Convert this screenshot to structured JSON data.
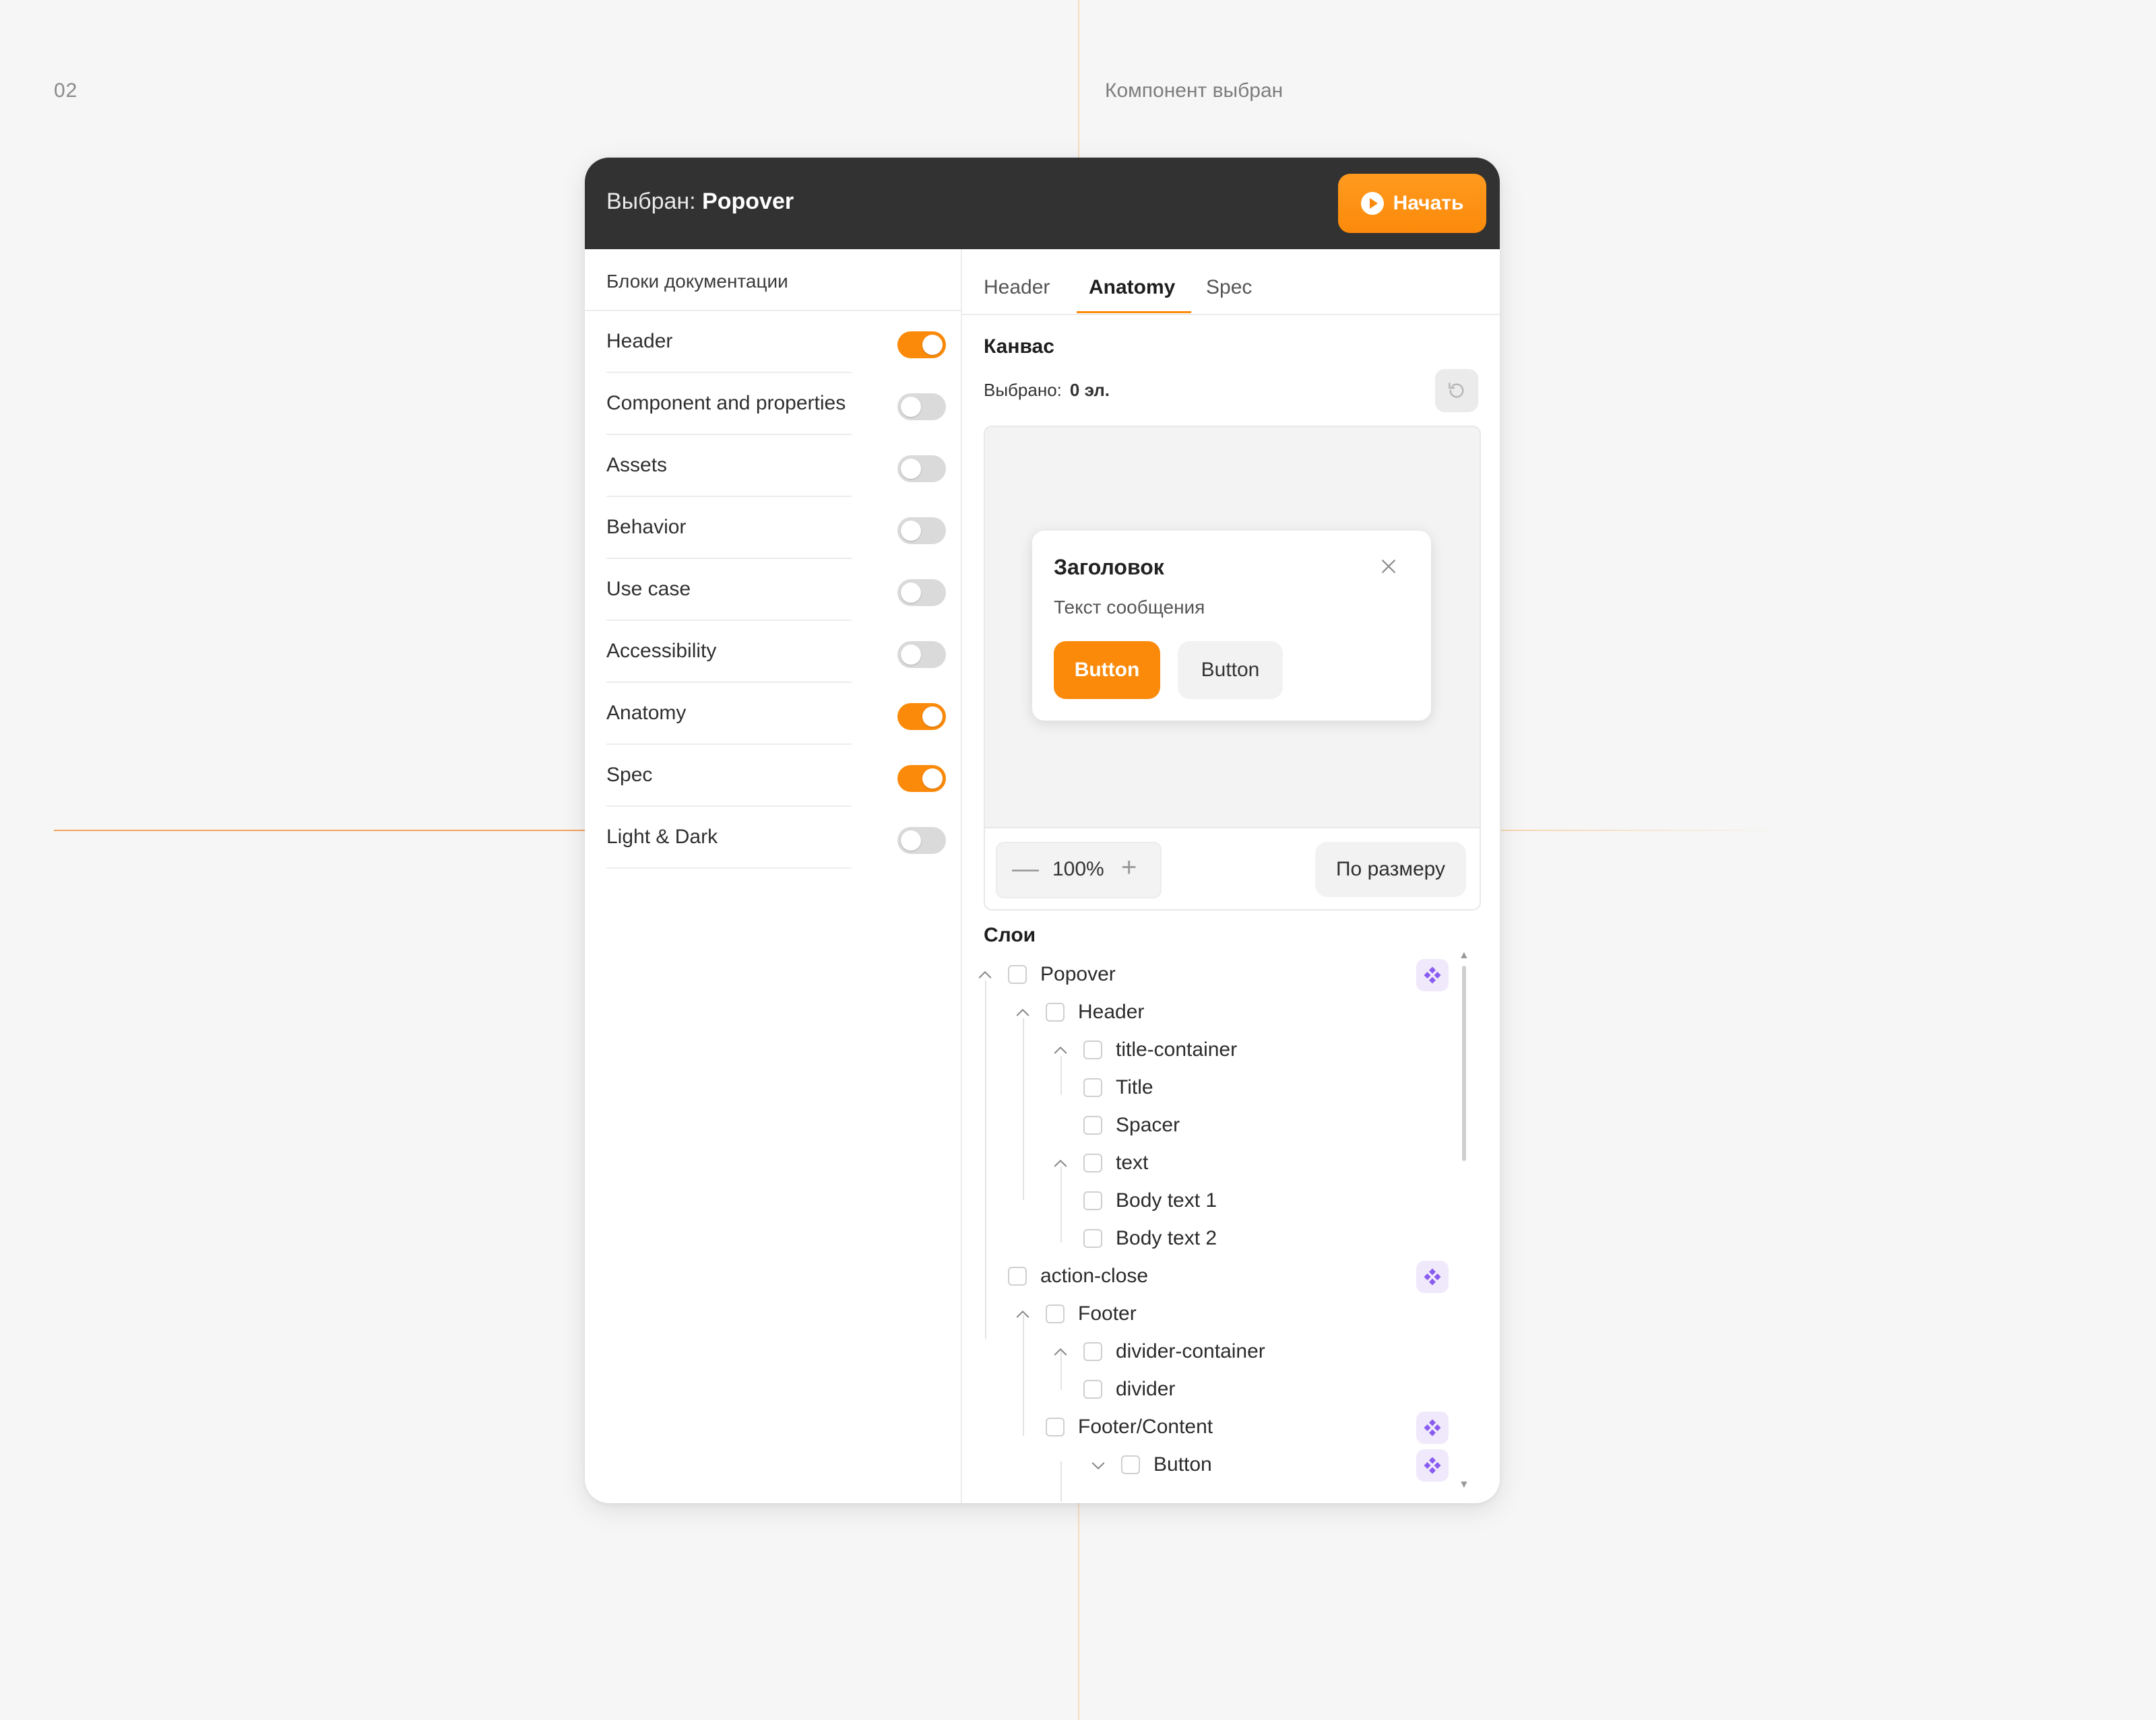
{
  "step": {
    "number": "02",
    "caption": "Компонент выбран"
  },
  "titlebar": {
    "prefix": "Выбран: ",
    "component": "Popover",
    "start_label": "Начать",
    "accent": "#fb8a0a",
    "bg": "#323232"
  },
  "blocks": {
    "heading": "Блоки документации",
    "items": [
      {
        "label": "Header",
        "on": true
      },
      {
        "label": "Component and properties",
        "on": false
      },
      {
        "label": "Assets",
        "on": false
      },
      {
        "label": "Behavior",
        "on": false
      },
      {
        "label": "Use case",
        "on": false
      },
      {
        "label": "Accessibility",
        "on": false
      },
      {
        "label": "Anatomy",
        "on": true
      },
      {
        "label": "Spec",
        "on": true
      },
      {
        "label": "Light & Dark",
        "on": false
      }
    ]
  },
  "tabs": [
    {
      "label": "Header",
      "active": false
    },
    {
      "label": "Anatomy",
      "active": true
    },
    {
      "label": "Spec",
      "active": false
    }
  ],
  "canvas": {
    "title": "Канвас",
    "selected_label": "Выбрано:",
    "selected_value": "0 эл.",
    "zoom": "100%",
    "zoom_minus": "—",
    "zoom_plus": "+",
    "fit_label": "По размеру",
    "popover": {
      "title": "Заголовок",
      "text": "Текст сообщения",
      "primary_button": "Button",
      "secondary_button": "Button"
    }
  },
  "layers": {
    "title": "Слои",
    "rows": [
      {
        "name": "Popover",
        "depth": 0,
        "chevron": "up",
        "component": true
      },
      {
        "name": "Header",
        "depth": 1,
        "chevron": "up",
        "component": false
      },
      {
        "name": "title-container",
        "depth": 2,
        "chevron": "up",
        "component": false
      },
      {
        "name": "Title",
        "depth": 2,
        "chevron": "none",
        "component": false
      },
      {
        "name": "Spacer",
        "depth": 2,
        "chevron": "none",
        "component": false
      },
      {
        "name": "text",
        "depth": 2,
        "chevron": "up",
        "component": false
      },
      {
        "name": "Body text 1",
        "depth": 2,
        "chevron": "none",
        "component": false
      },
      {
        "name": "Body text 2",
        "depth": 2,
        "chevron": "none",
        "component": false
      },
      {
        "name": "action-close",
        "depth": 0,
        "chevron": "none",
        "component": true
      },
      {
        "name": "Footer",
        "depth": 1,
        "chevron": "up",
        "component": false
      },
      {
        "name": "divider-container",
        "depth": 2,
        "chevron": "up",
        "component": false
      },
      {
        "name": "divider",
        "depth": 2,
        "chevron": "none",
        "component": false
      },
      {
        "name": "Footer/Content",
        "depth": 1,
        "chevron": "none",
        "component": true
      },
      {
        "name": "Button",
        "depth": 3,
        "chevron": "down",
        "component": true
      }
    ]
  }
}
